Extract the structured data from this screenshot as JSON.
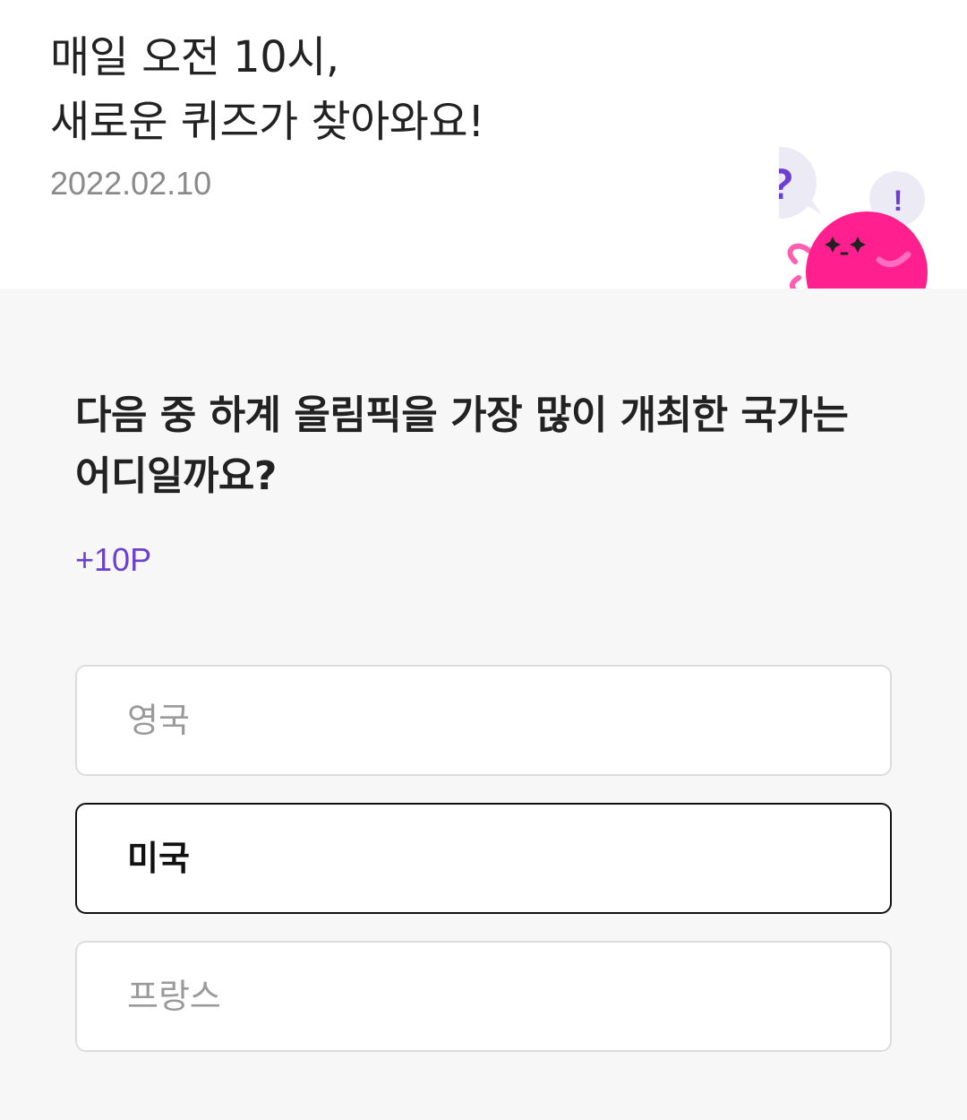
{
  "header": {
    "title_line1": "매일 오전 10시,",
    "title_line2": "새로운 퀴즈가 찾아와요!",
    "date": "2022.02.10"
  },
  "mascot": {
    "bubble_question": "?",
    "bubble_exclaim": "!",
    "body_color": "#ff1f8e",
    "accent_color": "#6b3fcf"
  },
  "quiz": {
    "question": "다음 중 하계 올림픽을 가장 많이 개최한 국가는 어디일까요?",
    "points": "+10P",
    "options": [
      {
        "label": "영국",
        "selected": false
      },
      {
        "label": "미국",
        "selected": true
      },
      {
        "label": "프랑스",
        "selected": false
      }
    ]
  }
}
